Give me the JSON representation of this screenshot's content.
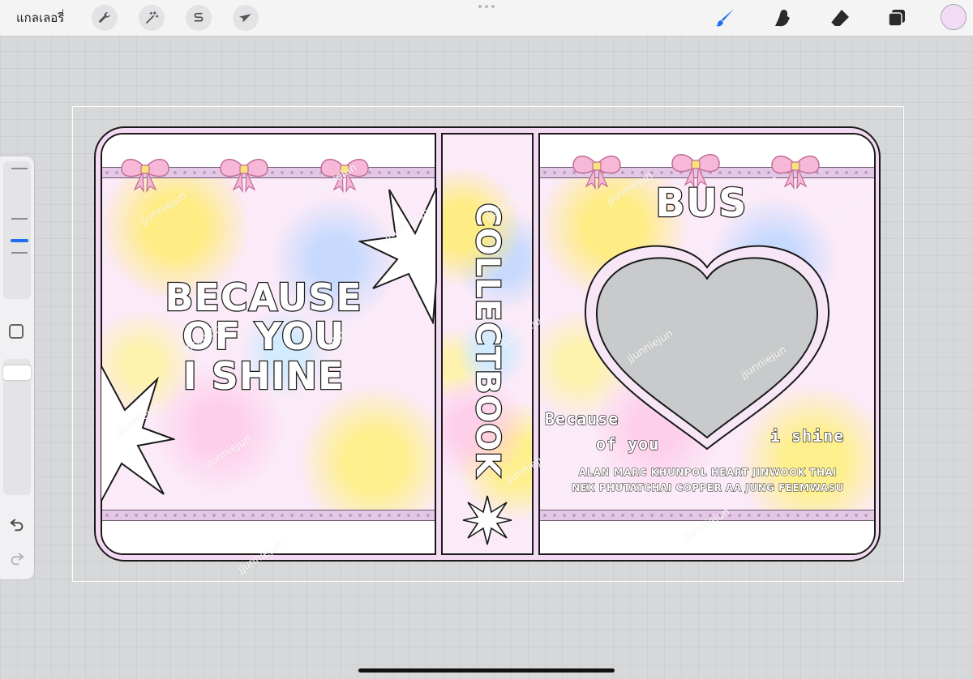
{
  "toolbar": {
    "gallery": "แกลเลอรี่",
    "actions_icon": "wrench-icon",
    "adjustments_icon": "magic-wand-icon",
    "selection_icon": "selection-s-icon",
    "transform_icon": "arrow-cursor-icon",
    "brush_icon": "brush-icon",
    "smudge_icon": "smudge-icon",
    "eraser_icon": "eraser-icon",
    "layers_icon": "layers-icon",
    "current_color": "#f2dcf5"
  },
  "colors": {
    "accent_blue": "#1e6ff0",
    "cover_pink": "#f3d9f1",
    "bow_pink": "#f6b8d6",
    "heart_fill": "#c8cacb"
  },
  "cover": {
    "left_title_line1": "BECAUSE",
    "left_title_line2": "OF YOU",
    "left_title_line3": "I SHINE",
    "spine_title": "COLLECTBOOK",
    "right_title": "BUS",
    "sub_left1": "Because",
    "sub_left2": "of you",
    "sub_right": "i shine",
    "members_line1": "ALAN MARC KHUNPOL HEART JINWOOK THAI",
    "members_line2": "NEX PHUTATCHAI COPPER AA JUNG FEEMWASU",
    "watermark": "jjunniejun"
  }
}
